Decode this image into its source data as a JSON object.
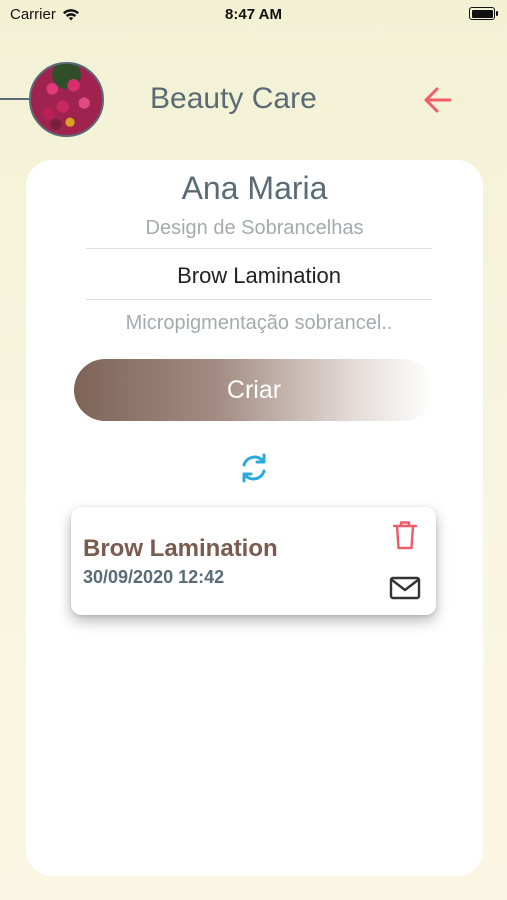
{
  "status_bar": {
    "carrier": "Carrier",
    "time": "8:47 AM"
  },
  "header": {
    "title": "Beauty Care",
    "back_icon": "arrow-left-icon",
    "avatar_icon": "flowers-photo"
  },
  "form": {
    "client_name": "Ana Maria",
    "service": "Design de Sobrancelhas",
    "procedure_value": "Brow Lamination",
    "description_value": "Micropigmentação sobrancel..",
    "create_label": "Criar",
    "refresh_icon": "refresh-icon"
  },
  "appointments": [
    {
      "title": "Brow Lamination",
      "datetime": "30/09/2020 12:42"
    }
  ],
  "colors": {
    "accent_red": "#ef5b67",
    "slate": "#5a6b76",
    "brown": "#7a5b4f",
    "blue": "#2aa8e0"
  }
}
